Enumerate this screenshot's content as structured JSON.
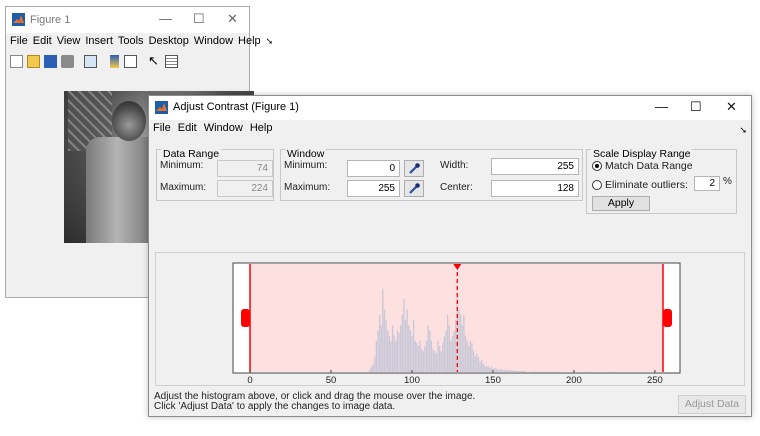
{
  "figure1": {
    "title": "Figure 1",
    "controls": {
      "minimize": "—",
      "maximize": "☐",
      "close": "✕"
    },
    "menu": [
      "File",
      "Edit",
      "View",
      "Insert",
      "Tools",
      "Desktop",
      "Window",
      "Help"
    ],
    "toolbar_icons": [
      "new-file-icon",
      "open-folder-icon",
      "save-icon",
      "print-icon",
      "link-plot-icon",
      "colorbar-icon",
      "legend-icon",
      "pointer-icon",
      "property-inspector-icon"
    ]
  },
  "adjust": {
    "title": "Adjust Contrast (Figure 1)",
    "controls": {
      "minimize": "—",
      "maximize": "☐",
      "close": "✕"
    },
    "menu": [
      "File",
      "Edit",
      "Window",
      "Help"
    ],
    "data_range": {
      "title": "Data Range",
      "min_label": "Minimum:",
      "min_value": "74",
      "max_label": "Maximum:",
      "max_value": "224"
    },
    "window": {
      "title": "Window",
      "min_label": "Minimum:",
      "min_value": "0",
      "max_label": "Maximum:",
      "max_value": "255",
      "width_label": "Width:",
      "width_value": "255",
      "center_label": "Center:",
      "center_value": "128"
    },
    "scale": {
      "title": "Scale Display Range",
      "match_label": "Match Data Range",
      "outliers_label": "Eliminate outliers:",
      "outliers_value": "2",
      "percent": "%",
      "apply_label": "Apply",
      "selected": "match"
    },
    "hint_line1": "Adjust the histogram above, or click and drag the mouse over the image.",
    "hint_line2": "Click 'Adjust Data' to apply the changes to image data.",
    "adjust_data_label": "Adjust Data"
  },
  "chart_data": {
    "type": "bar",
    "xlim": [
      0,
      255
    ],
    "xticks": [
      0,
      50,
      100,
      150,
      200,
      250
    ],
    "window_min": 0,
    "window_max": 255,
    "window_center": 128,
    "colors": {
      "window_fill": "#fde0e0",
      "window_line": "#ff0000",
      "bars": "#c8c8d8"
    },
    "x": [
      74,
      75,
      76,
      77,
      78,
      79,
      80,
      81,
      82,
      83,
      84,
      85,
      86,
      87,
      88,
      89,
      90,
      91,
      92,
      93,
      94,
      95,
      96,
      97,
      98,
      99,
      100,
      101,
      102,
      103,
      104,
      105,
      106,
      107,
      108,
      109,
      110,
      111,
      112,
      113,
      114,
      115,
      116,
      117,
      118,
      119,
      120,
      121,
      122,
      123,
      124,
      125,
      126,
      127,
      128,
      129,
      130,
      131,
      132,
      133,
      134,
      135,
      136,
      137,
      138,
      139,
      140,
      141,
      142,
      143,
      144,
      145,
      146,
      147,
      148,
      149,
      150,
      151,
      152,
      153,
      154,
      155,
      156,
      157,
      158,
      159,
      160,
      161,
      162,
      163,
      164,
      165,
      166,
      167,
      168,
      169,
      170,
      175,
      180,
      185,
      190,
      200,
      210,
      224
    ],
    "values": [
      0.03,
      0.05,
      0.08,
      0.15,
      0.3,
      0.4,
      0.55,
      0.45,
      0.8,
      0.6,
      0.5,
      0.4,
      0.35,
      0.3,
      0.45,
      0.35,
      0.3,
      0.4,
      0.38,
      0.45,
      0.55,
      0.7,
      0.5,
      0.6,
      0.45,
      0.4,
      0.35,
      0.5,
      0.3,
      0.28,
      0.25,
      0.3,
      0.22,
      0.2,
      0.25,
      0.3,
      0.45,
      0.4,
      0.3,
      0.22,
      0.2,
      0.18,
      0.3,
      0.25,
      0.2,
      0.28,
      0.35,
      0.4,
      0.55,
      0.45,
      0.3,
      0.35,
      0.4,
      0.5,
      0.75,
      0.6,
      0.55,
      0.45,
      0.55,
      0.35,
      0.3,
      0.25,
      0.3,
      0.28,
      0.2,
      0.15,
      0.18,
      0.14,
      0.1,
      0.12,
      0.08,
      0.06,
      0.05,
      0.06,
      0.04,
      0.05,
      0.03,
      0.04,
      0.03,
      0.03,
      0.02,
      0.03,
      0.02,
      0.02,
      0.02,
      0.02,
      0.015,
      0.02,
      0.015,
      0.015,
      0.01,
      0.01,
      0.01,
      0.01,
      0.01,
      0.01,
      0.01,
      0.008,
      0.006,
      0.005,
      0.004,
      0.003,
      0.002,
      0.001
    ]
  }
}
